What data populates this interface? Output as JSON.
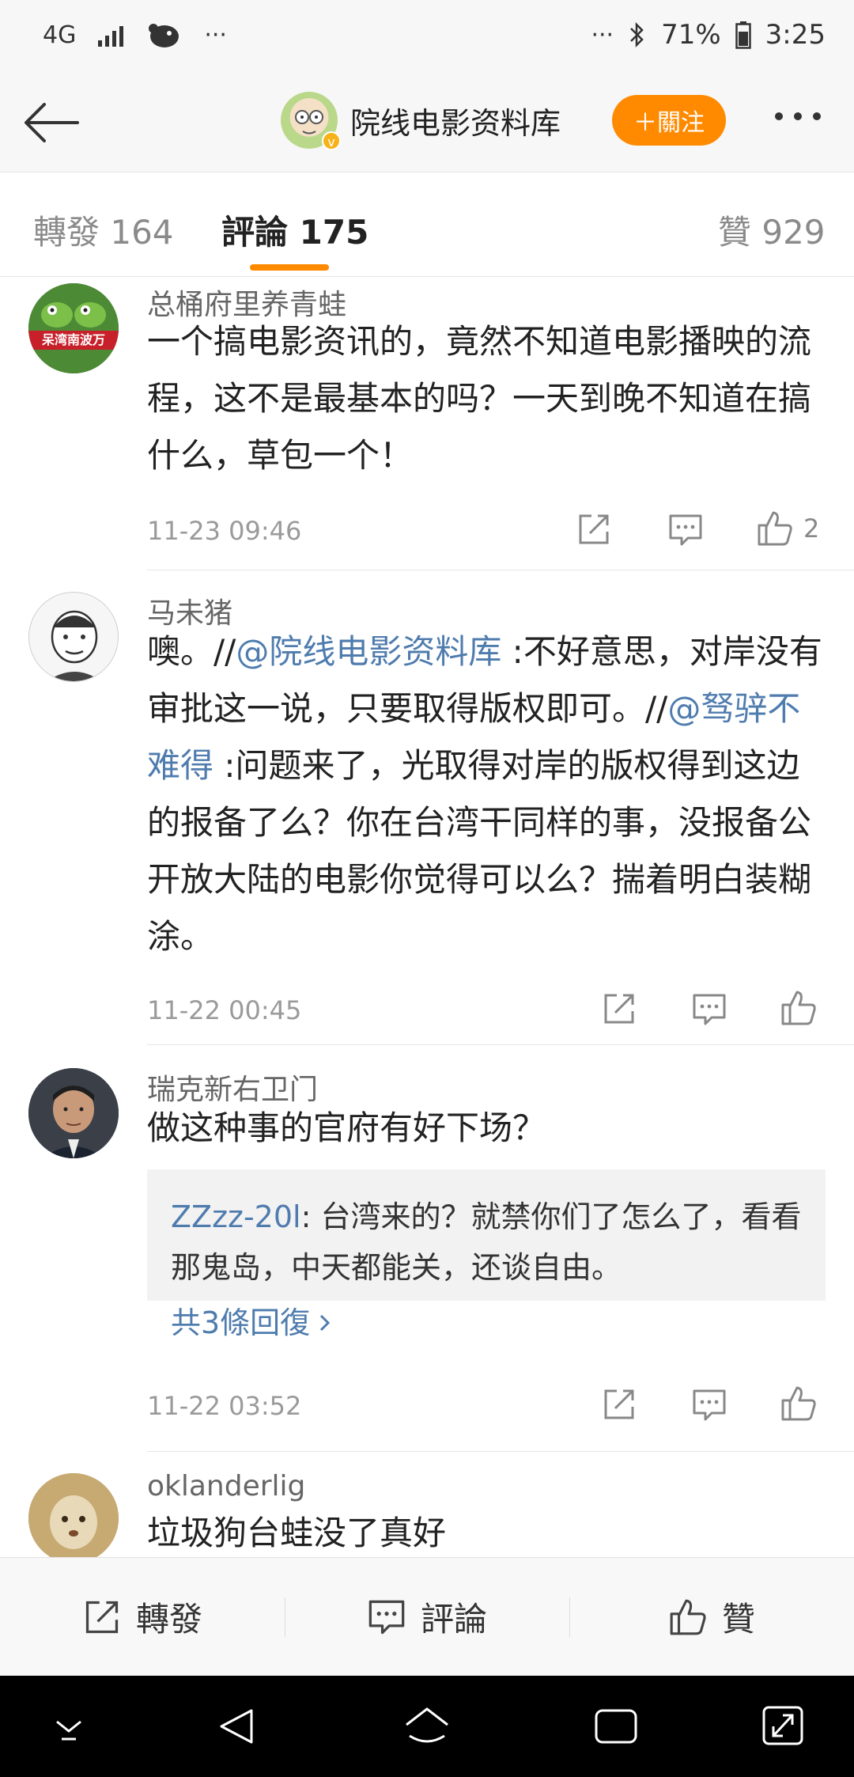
{
  "status_bar": {
    "network": "4G",
    "dots_left": "···",
    "dots_right": "···",
    "battery": "71%",
    "time": "3:25"
  },
  "nav": {
    "back_icon": "back-arrow-icon",
    "title": "院线电影资料库",
    "follow_label": "＋關注",
    "more_icon": "more-dots-icon"
  },
  "tabs": {
    "repost": "轉發 164",
    "comment": "評論 175",
    "like": "贊 929",
    "active": "comment"
  },
  "comments": [
    {
      "name": "总桶府里养青蛙",
      "text": "一个搞电影资讯的，竟然不知道电影播映的流程，这不是最基本的吗？一天到晚不知道在搞什么，草包一个！",
      "date": "11-23 09:46",
      "likes": "2",
      "avatar_text": "呆湾南波万"
    },
    {
      "name": "马未猪",
      "text_pre": "噢。//",
      "mention1": "@院线电影资料库",
      "text_mid": " :不好意思，对岸没有审批这一说，只要取得版权即可。//",
      "mention2": "@驽骍不难得",
      "text_post": " :问题来了，光取得对岸的版权得到这边的报备了么？你在台湾干同样的事，没报备公开放大陆的电影你觉得可以么？揣着明白装糊涂。",
      "date": "11-22 00:45",
      "likes": ""
    },
    {
      "name": "瑞克新右卫门",
      "text": "做这种事的官府有好下场？",
      "reply": {
        "name": "ZZzz-20l",
        "text": ": 台湾来的？就禁你们了怎么了，看看那鬼岛，中天都能关，还谈自由。",
        "more": "共3條回復"
      },
      "date": "11-22 03:52",
      "likes": ""
    },
    {
      "name": "oklanderlig",
      "text": "垃圾狗台蛙没了真好"
    }
  ],
  "action_bar": {
    "repost": "轉發",
    "comment": "評論",
    "like": "贊"
  },
  "colors": {
    "accent": "#ff8a00",
    "link": "#4f7cae",
    "muted": "#9a9a9a"
  }
}
